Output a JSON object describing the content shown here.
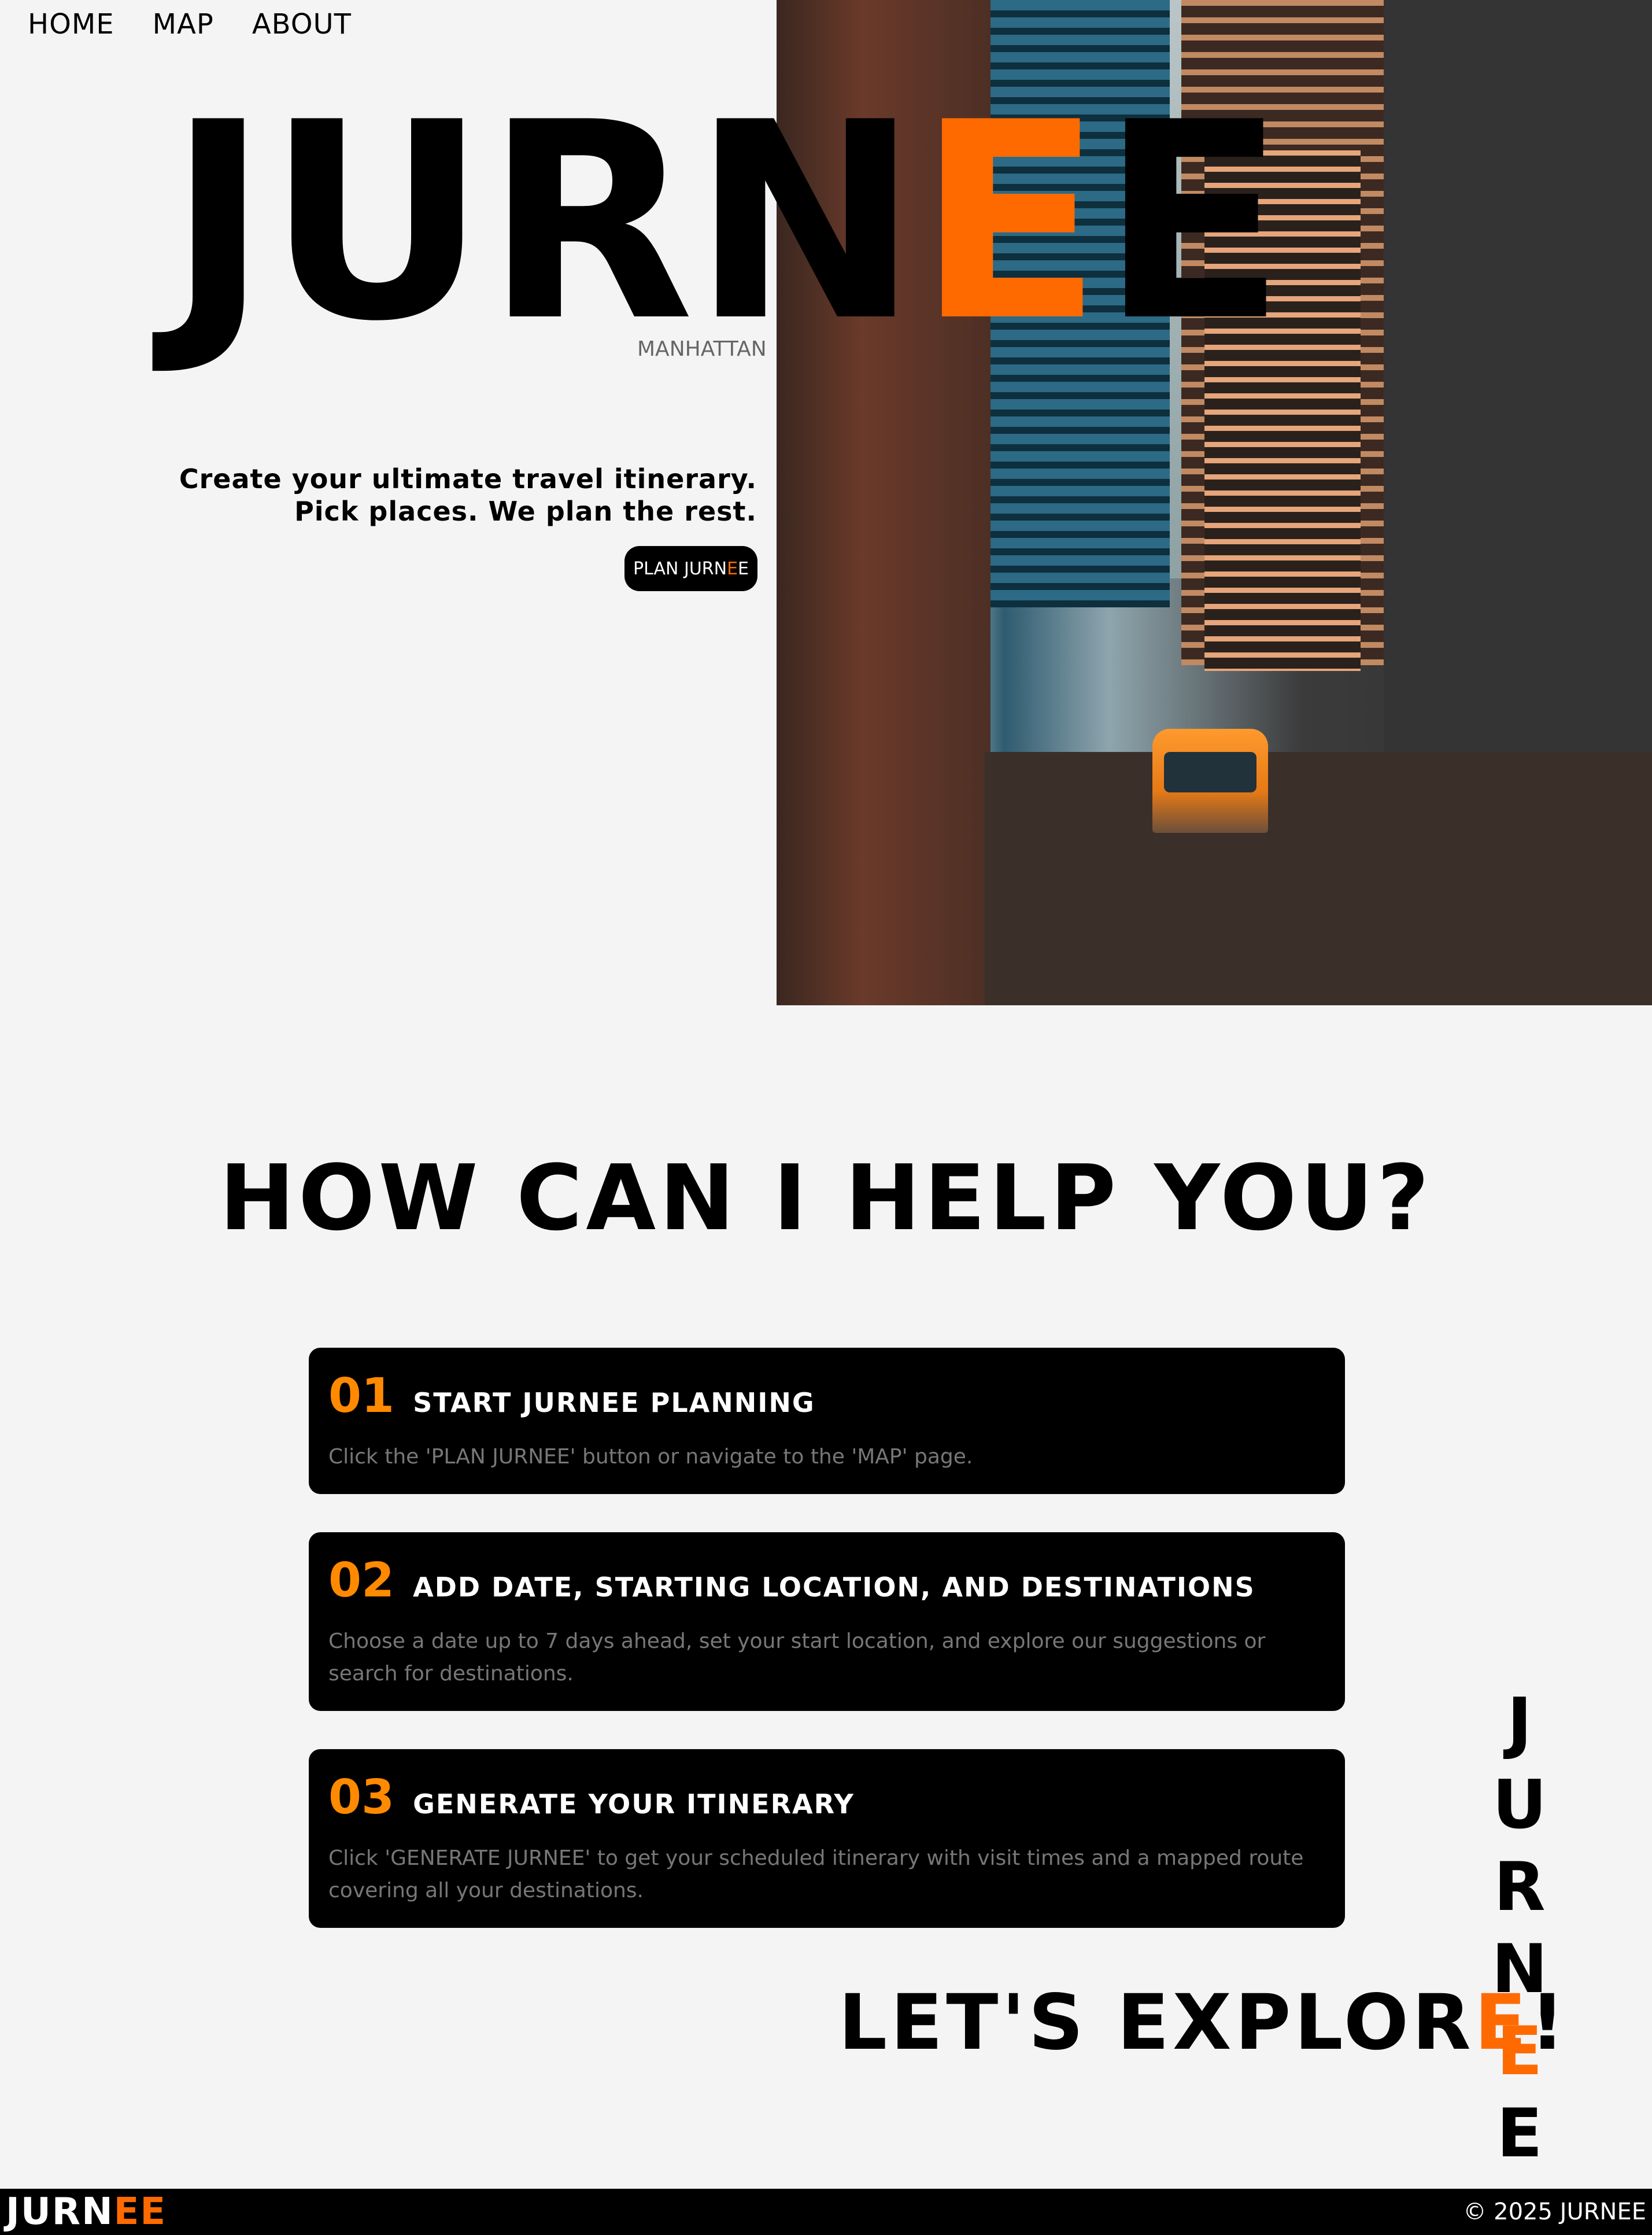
{
  "nav": {
    "items": [
      "HOME",
      "MAP",
      "ABOUT"
    ]
  },
  "hero": {
    "brand_a": "JURN",
    "brand_accent": "E",
    "brand_b": "E",
    "location": "MANHATTAN",
    "tagline_line1": "Create your ultimate travel itinerary.",
    "tagline_line2": "Pick places. We plan the rest.",
    "cta_a": "PLAN JURN",
    "cta_accent": "E",
    "cta_b": "E"
  },
  "help": {
    "title": "HOW CAN I HELP YOU?",
    "steps": [
      {
        "num": "01",
        "title": "START JURNEE PLANNING",
        "desc": "Click the 'PLAN JURNEE' button or navigate to the 'MAP' page."
      },
      {
        "num": "02",
        "title": "ADD DATE, STARTING LOCATION, AND DESTINATIONS",
        "desc": "Choose a date up to 7 days ahead, set your start location, and explore our suggestions or search for destinations."
      },
      {
        "num": "03",
        "title": "GENERATE YOUR ITINERARY",
        "desc": "Click 'GENERATE JURNEE' to get your scheduled itinerary with visit times and a mapped route covering all your destinations."
      }
    ]
  },
  "explore": {
    "text_a": "LET'S EXPLOR",
    "text_accent": "E",
    "text_b": "!",
    "vertical": [
      "J",
      "U",
      "R",
      "N",
      "E",
      "E"
    ]
  },
  "footer": {
    "logo_a": "JURN",
    "logo_accent": "EE",
    "copyright": "© 2025 JURNEE"
  },
  "colors": {
    "accent": "#ff6a00",
    "step_number": "#ff8a00",
    "background": "#f4f4f4"
  }
}
